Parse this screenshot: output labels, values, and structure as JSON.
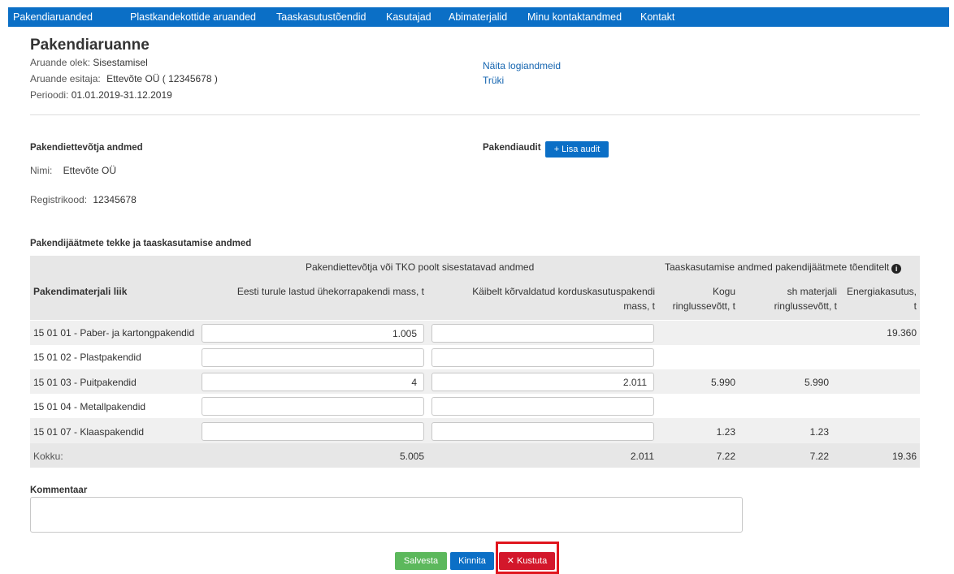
{
  "nav": {
    "items": [
      "Pakendiaruanded",
      "Plastkandekottide aruanded",
      "Taaskasutustõendid",
      "Kasutajad",
      "Abimaterjalid",
      "Minu kontaktandmed",
      "Kontakt"
    ]
  },
  "report": {
    "title": "Pakendiaruanne",
    "status_label": "Aruande olek:",
    "status_value": "Sisestamisel",
    "submitter_label": "Aruande esitaja:",
    "submitter_value": "Ettevõte OÜ",
    "submitter_code": "( 12345678 )",
    "period_label": "Perioodi:",
    "period_value": "01.01.2019-31.12.2019",
    "log_link": "Näita logiandmeid",
    "print_link": "Trüki"
  },
  "company": {
    "section_title": "Pakendiettevõtja andmed",
    "name_label": "Nimi:",
    "name_value": "Ettevõte OÜ",
    "regcode_label": "Registrikood:",
    "regcode_value": "12345678"
  },
  "audit": {
    "label": "Pakendiaudit",
    "add_button": "+ Lisa audit"
  },
  "waste": {
    "section_title": "Pakendijäätmete tekke ja taaskasutamise andmed",
    "group_header_entered": "Pakendiettevõtja või TKO poolt sisestatavad andmed",
    "group_header_recovery": "Taaskasutamise andmed pakendijäätmete tõenditelt",
    "info_icon": "i",
    "col_material": "Pakendimaterjali liik",
    "col_single_use": "Eesti turule lastud ühekorrapakendi mass, t",
    "col_reusable_line1": "Käibelt kõrvaldatud korduskasutuspakendi",
    "col_reusable_line2": "mass, t",
    "col_recycling_line1": "Kogu",
    "col_recycling_line2": "ringlussevõtt, t",
    "col_material_recycling_line1": "sh materjali",
    "col_material_recycling_line2": "ringlussevõtt, t",
    "col_energy_line1": "Energiakasutus,",
    "col_energy_line2": "t",
    "rows": [
      {
        "material": "15 01 01 - Paber- ja kartongpakendid",
        "single_use": "1.005",
        "reusable": "",
        "recycling": "",
        "material_recycling": "",
        "energy": "19.360"
      },
      {
        "material": "15 01 02 - Plastpakendid",
        "single_use": "",
        "reusable": "",
        "recycling": "",
        "material_recycling": "",
        "energy": ""
      },
      {
        "material": "15 01 03 - Puitpakendid",
        "single_use": "4",
        "reusable": "2.011",
        "recycling": "5.990",
        "material_recycling": "5.990",
        "energy": ""
      },
      {
        "material": "15 01 04 - Metallpakendid",
        "single_use": "",
        "reusable": "",
        "recycling": "",
        "material_recycling": "",
        "energy": ""
      },
      {
        "material": "15 01 07 - Klaaspakendid",
        "single_use": "",
        "reusable": "",
        "recycling": "1.23",
        "material_recycling": "1.23",
        "energy": ""
      }
    ],
    "total": {
      "label": "Kokku:",
      "single_use": "5.005",
      "reusable": "2.011",
      "recycling": "7.22",
      "material_recycling": "7.22",
      "energy": "19.36"
    }
  },
  "comment": {
    "label": "Kommentaar",
    "value": ""
  },
  "actions": {
    "save": "Salvesta",
    "confirm": "Kinnita",
    "delete": "Kustuta",
    "delete_icon": "✕"
  },
  "colors": {
    "nav_bg": "#0b6fc6",
    "primary": "#0b6fc6",
    "success": "#5cb85c",
    "danger": "#d3172b",
    "highlight": "#e0161e"
  }
}
